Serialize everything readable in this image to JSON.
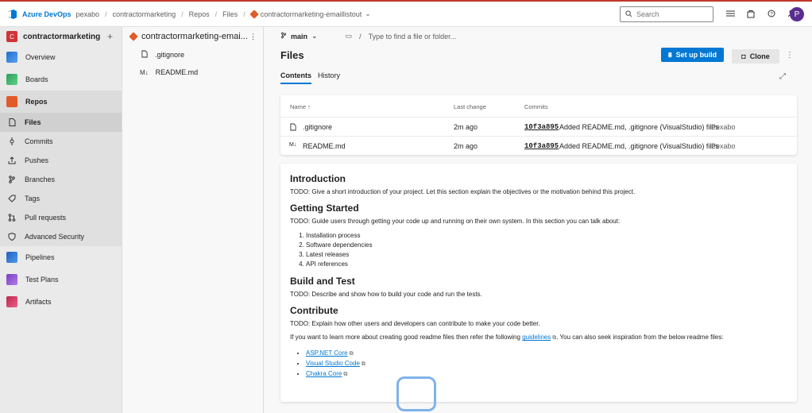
{
  "topbar": {
    "brand": "Azure DevOps",
    "org": "pexabo",
    "project": "contractormarketing",
    "section": "Repos",
    "page": "Files",
    "repo": "contractormarketing-emaillistout",
    "search_placeholder": "Search",
    "avatar_initial": "P"
  },
  "sidebar": {
    "project_initial": "C",
    "project_name": "contractormarketing",
    "items": [
      {
        "label": "Overview"
      },
      {
        "label": "Boards"
      },
      {
        "label": "Repos"
      },
      {
        "label": "Files"
      },
      {
        "label": "Commits"
      },
      {
        "label": "Pushes"
      },
      {
        "label": "Branches"
      },
      {
        "label": "Tags"
      },
      {
        "label": "Pull requests"
      },
      {
        "label": "Advanced Security"
      },
      {
        "label": "Pipelines"
      },
      {
        "label": "Test Plans"
      },
      {
        "label": "Artifacts"
      }
    ]
  },
  "filetree": {
    "repo_name": "contractormarketing-emai...",
    "files": [
      {
        "name": ".gitignore"
      },
      {
        "name": "README.md"
      }
    ]
  },
  "main": {
    "branch": "main",
    "path_placeholder": "Type to find a file or folder...",
    "title": "Files",
    "setup_build": "Set up build",
    "clone": "Clone",
    "tabs": [
      {
        "label": "Contents"
      },
      {
        "label": "History"
      }
    ],
    "table": {
      "headers": [
        "Name ↑",
        "Last change",
        "Commits"
      ],
      "rows": [
        {
          "name": ".gitignore",
          "last_change": "2m ago",
          "hash": "10f3a895",
          "message": "Added README.md, .gitignore (VisualStudio) files",
          "author": "Pexabo"
        },
        {
          "name": "README.md",
          "last_change": "2m ago",
          "hash": "10f3a895",
          "message": "Added README.md, .gitignore (VisualStudio) files",
          "author": "Pexabo"
        }
      ]
    }
  },
  "readme": {
    "intro_title": "Introduction",
    "intro_text": "TODO: Give a short introduction of your project. Let this section explain the objectives or the motivation behind this project.",
    "gs_title": "Getting Started",
    "gs_text": "TODO: Guide users through getting your code up and running on their own system. In this section you can talk about:",
    "gs_steps": [
      "Installation process",
      "Software dependencies",
      "Latest releases",
      "API references"
    ],
    "bt_title": "Build and Test",
    "bt_text": "TODO: Describe and show how to build your code and run the tests.",
    "contrib_title": "Contribute",
    "contrib_text": "TODO: Explain how other users and developers can contribute to make your code better.",
    "learn_pre": "If you want to learn more about creating good readme files then refer the following",
    "learn_link": "guidelines",
    "learn_post": ". You can also seek inspiration from the below readme files:",
    "links": [
      "ASP.NET Core",
      "Visual Studio Code",
      "Chakra Core"
    ]
  },
  "colors": {
    "accent": "#0078d4",
    "git": "#e05b29",
    "project": "#d13438",
    "avatar": "#5c2d91"
  }
}
